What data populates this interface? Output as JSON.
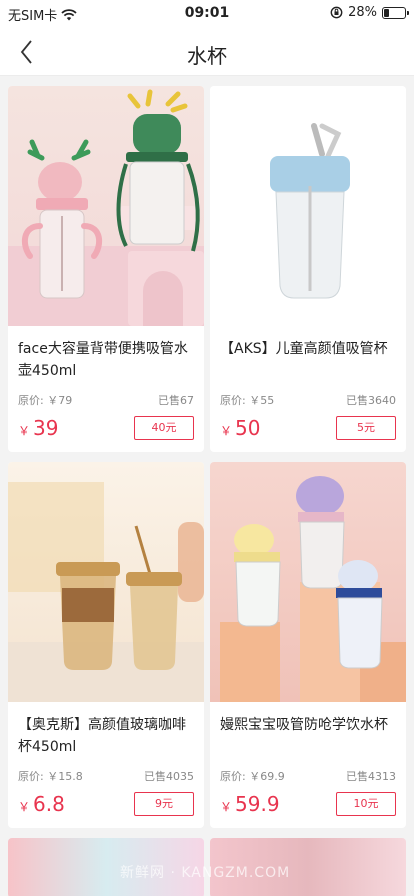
{
  "status": {
    "carrier": "无SIM卡",
    "time": "09:01",
    "battery": "28%",
    "battery_level": 0.28
  },
  "nav": {
    "title": "水杯"
  },
  "products": [
    {
      "name": "face大容量背带便携吸管水壶450ml",
      "original_price": "原价: ￥79",
      "sold": "已售67",
      "yen": "￥",
      "price": "39",
      "coupon": "40元"
    },
    {
      "name": "【AKS】儿童高颜值吸管杯",
      "original_price": "原价: ￥55",
      "sold": "已售3640",
      "yen": "￥",
      "price": "50",
      "coupon": "5元"
    },
    {
      "name": "【奥克斯】高颜值玻璃咖啡杯450ml",
      "original_price": "原价: ￥15.8",
      "sold": "已售4035",
      "yen": "￥",
      "price": "6.8",
      "coupon": "9元"
    },
    {
      "name": "嫚熙宝宝吸管防呛学饮水杯",
      "original_price": "原价: ￥69.9",
      "sold": "已售4313",
      "yen": "￥",
      "price": "59.9",
      "coupon": "10元"
    }
  ],
  "watermark": "新鲜网 · KANGZM.COM"
}
